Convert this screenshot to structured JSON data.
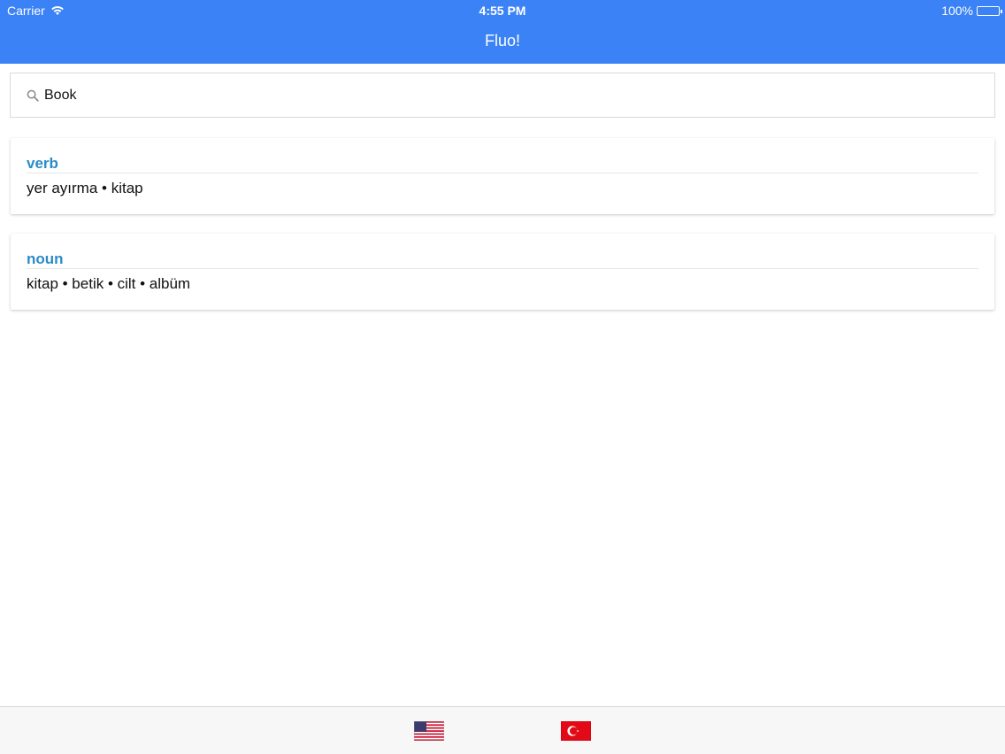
{
  "status_bar": {
    "carrier": "Carrier",
    "time": "4:55 PM",
    "battery": "100%"
  },
  "nav": {
    "title": "Fluo!"
  },
  "search": {
    "value": "Book",
    "icon": "search-icon"
  },
  "results": [
    {
      "part_of_speech": "verb",
      "translations": "yer ayırma • kitap"
    },
    {
      "part_of_speech": "noun",
      "translations": "kitap • betik • cilt • albüm"
    }
  ],
  "tab_bar": {
    "items": [
      {
        "icon": "us-flag-icon"
      },
      {
        "icon": "turkey-flag-icon"
      }
    ]
  },
  "colors": {
    "header": "#3b82f6",
    "pos_label": "#2a8bc9"
  }
}
